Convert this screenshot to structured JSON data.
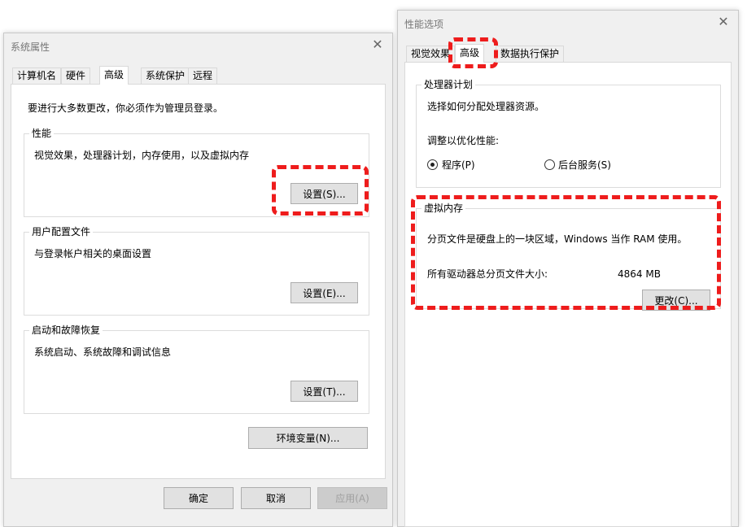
{
  "system_properties": {
    "title": "系统属性",
    "tabs": [
      "计算机名",
      "硬件",
      "高级",
      "系统保护",
      "远程"
    ],
    "admin_note": "要进行大多数更改，你必须作为管理员登录。",
    "performance": {
      "title": "性能",
      "desc": "视觉效果，处理器计划，内存使用，以及虚拟内存",
      "button": "设置(S)..."
    },
    "user_profiles": {
      "title": "用户配置文件",
      "desc": "与登录帐户相关的桌面设置",
      "button": "设置(E)..."
    },
    "startup_recovery": {
      "title": "启动和故障恢复",
      "desc": "系统启动、系统故障和调试信息",
      "button": "设置(T)..."
    },
    "env_button": "环境变量(N)...",
    "ok": "确定",
    "cancel": "取消",
    "apply": "应用(A)"
  },
  "performance_options": {
    "title": "性能选项",
    "tabs": [
      "视觉效果",
      "高级",
      "数据执行保护"
    ],
    "processor": {
      "title": "处理器计划",
      "desc": "选择如何分配处理器资源。",
      "adjust": "调整以优化性能:",
      "opt_programs": "程序(P)",
      "opt_background": "后台服务(S)",
      "selected": "程序(P)"
    },
    "virtual_memory": {
      "title": "虚拟内存",
      "desc": "分页文件是硬盘上的一块区域，Windows 当作 RAM 使用。",
      "total_label": "所有驱动器总分页文件大小:",
      "total_value": "4864 MB",
      "button": "更改(C)..."
    }
  },
  "colors": {
    "highlight": "#ee1c1c",
    "window_bg": "#f0f0f0"
  },
  "icons": {
    "close": "close-icon"
  }
}
